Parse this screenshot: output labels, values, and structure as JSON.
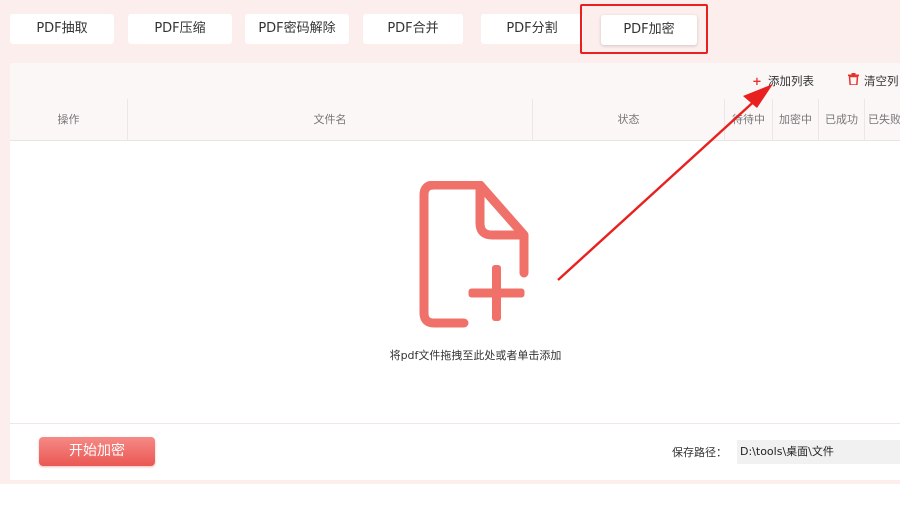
{
  "tabs": [
    {
      "label": "PDF抽取"
    },
    {
      "label": "PDF压缩"
    },
    {
      "label": "PDF密码解除"
    },
    {
      "label": "PDF合并"
    },
    {
      "label": "PDF分割"
    },
    {
      "label": "PDF加密"
    }
  ],
  "active_tab": "PDF加密",
  "toolbar": {
    "add_list_label": "添加列表",
    "clear_list_label": "清空列"
  },
  "table": {
    "columns": [
      "操作",
      "文件名",
      "状态",
      "待待中",
      "加密中",
      "已成功",
      "已失败"
    ]
  },
  "dropzone": {
    "hint": "将pdf文件拖拽至此处或者单击添加",
    "icon": "file-add-icon"
  },
  "footer": {
    "start_button_label": "开始加密",
    "save_path_label": "保存路径：",
    "save_path_value": "D:\\tools\\桌面\\文件"
  },
  "colors": {
    "accent": "#e8322e",
    "icon": "#f0706a",
    "annotation": "#e8201f",
    "background": "#fdeeee"
  }
}
